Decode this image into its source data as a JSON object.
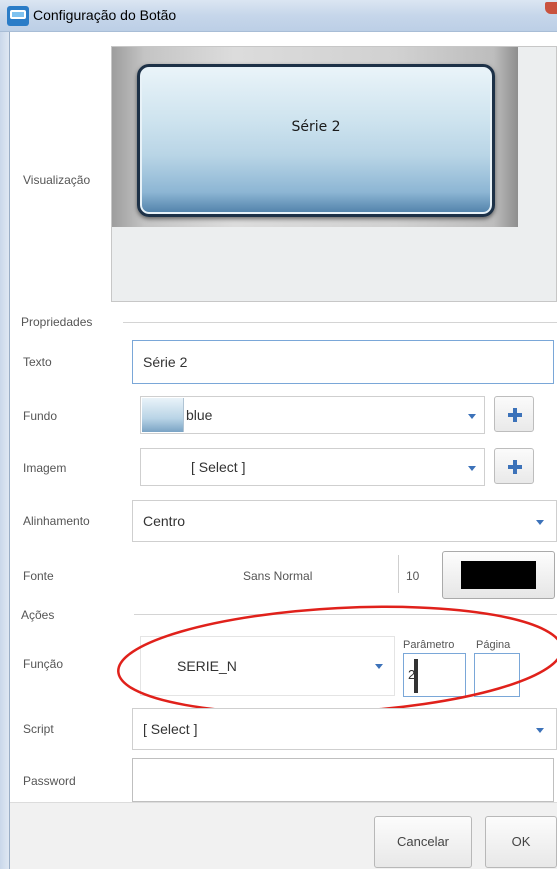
{
  "window": {
    "title": "Configuração do Botão",
    "app_icon": "app-logo-icon"
  },
  "preview": {
    "label": "Visualização",
    "button_text": "Série 2"
  },
  "sections": {
    "properties": "Propriedades",
    "actions": "Ações"
  },
  "properties": {
    "text_label": "Texto",
    "text_value": "Série 2",
    "background_label": "Fundo",
    "background_value": "blue",
    "image_label": "Imagem",
    "image_value": "[ Select ]",
    "alignment_label": "Alinhamento",
    "alignment_value": "Centro",
    "font_label": "Fonte",
    "font_value": "Sans Normal",
    "font_size": "10",
    "font_color": "#000000"
  },
  "actions": {
    "function_label": "Função",
    "function_value": "SERIE_N",
    "parameter_label": "Parâmetro",
    "parameter_value": "2",
    "page_label": "Página",
    "page_value": "",
    "script_label": "Script",
    "script_value": "[ Select ]",
    "password_label": "Password",
    "password_value": ""
  },
  "buttons": {
    "cancel": "Cancelar",
    "ok": "OK"
  },
  "colors": {
    "accent": "#3c72b9",
    "annotation": "#e0211b"
  }
}
